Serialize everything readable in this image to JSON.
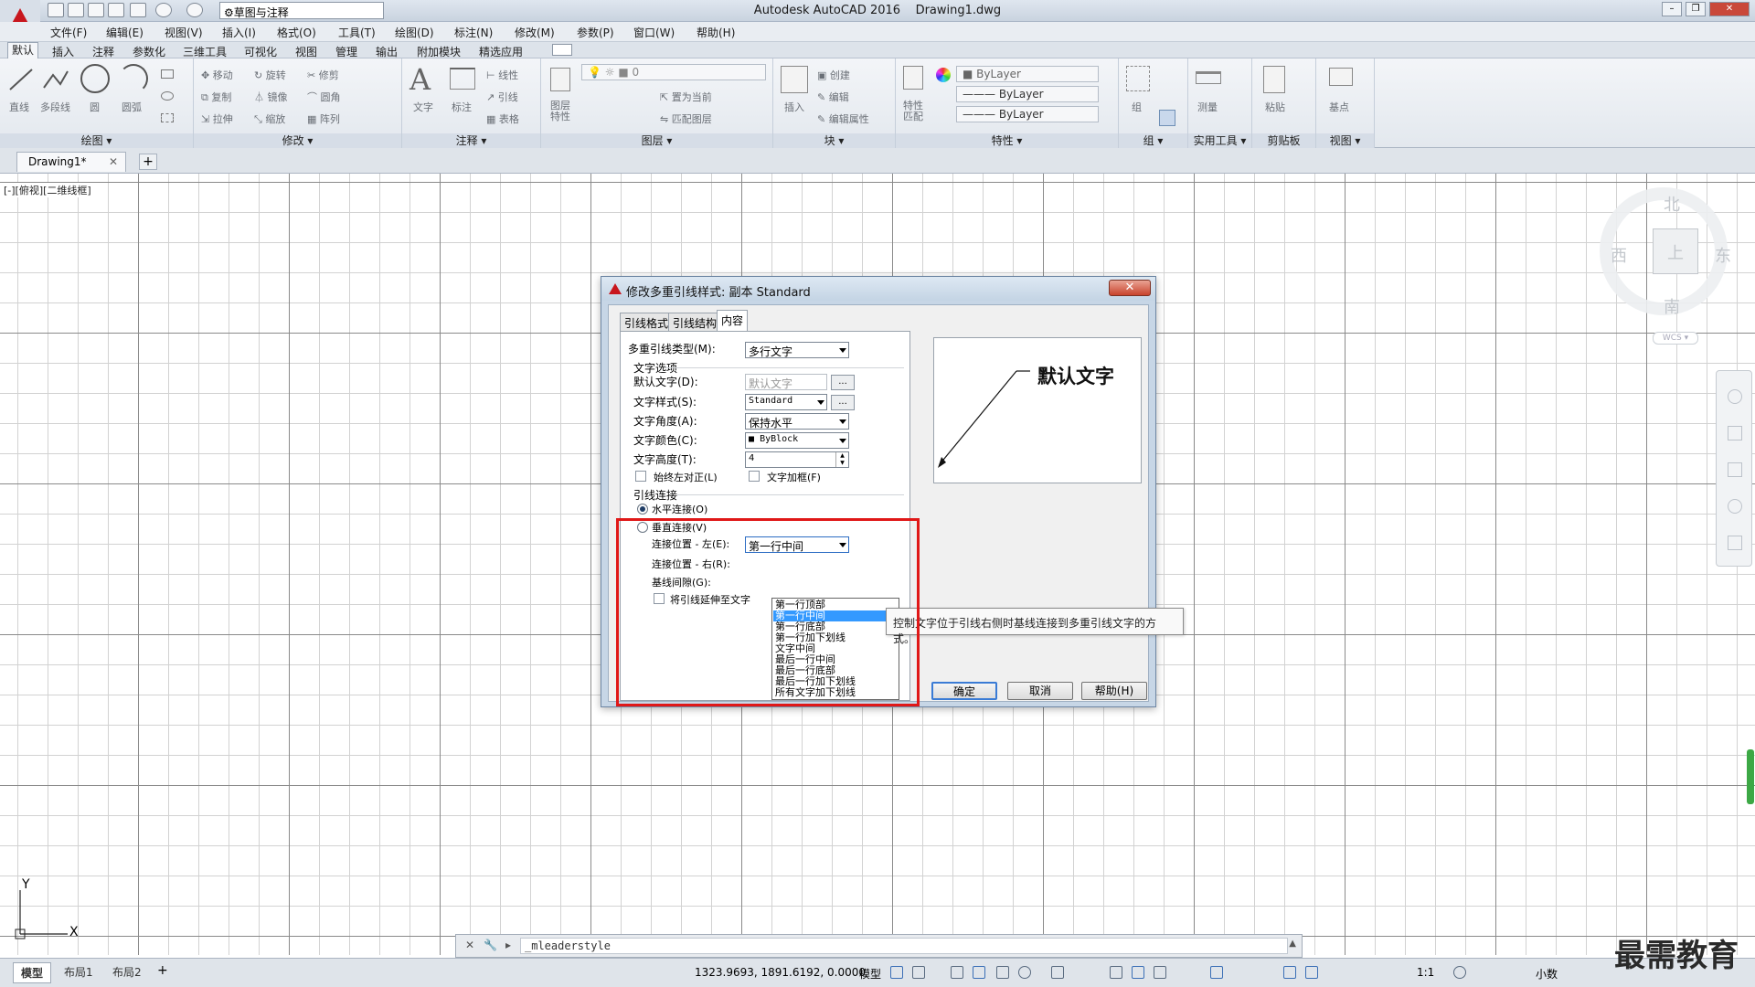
{
  "titlebar": {
    "workspace": "草图与注释",
    "app_title": "Autodesk AutoCAD 2016",
    "drawing_name": "Drawing1.dwg"
  },
  "menubar": [
    "文件(F)",
    "编辑(E)",
    "视图(V)",
    "插入(I)",
    "格式(O)",
    "工具(T)",
    "绘图(D)",
    "标注(N)",
    "修改(M)",
    "参数(P)",
    "窗口(W)",
    "帮助(H)"
  ],
  "ribbon_tabs": [
    "默认",
    "插入",
    "注释",
    "参数化",
    "三维工具",
    "可视化",
    "视图",
    "管理",
    "输出",
    "附加模块",
    "精选应用"
  ],
  "ribbon": {
    "draw": {
      "title": "绘图",
      "tools": [
        "直线",
        "多段线",
        "圆",
        "圆弧"
      ]
    },
    "modify": {
      "title": "修改",
      "tools": [
        "移动",
        "旋转",
        "修剪",
        "复制",
        "镜像",
        "圆角",
        "拉伸",
        "缩放",
        "阵列"
      ]
    },
    "annotation": {
      "title": "注释",
      "tools": [
        "文字",
        "标注",
        "线性",
        "引线",
        "表格"
      ]
    },
    "layers": {
      "title": "图层",
      "tools": [
        "图层特性",
        "置为当前",
        "匹配图层"
      ],
      "current_layer": "0"
    },
    "block": {
      "title": "块",
      "tools": [
        "插入",
        "创建",
        "编辑",
        "编辑属性"
      ]
    },
    "properties": {
      "title": "特性",
      "tools": [
        "特性匹配"
      ],
      "color": "ByLayer",
      "linetype": "ByLayer",
      "lineweight": "ByLayer"
    },
    "groups": {
      "title": "组",
      "tools": [
        "组"
      ]
    },
    "utilities": {
      "title": "实用工具",
      "tools": [
        "测量"
      ]
    },
    "clipboard": {
      "title": "剪贴板",
      "tools": [
        "粘贴"
      ]
    },
    "view": {
      "title": "视图",
      "tools": [
        "基点"
      ]
    }
  },
  "doc_tab": "Drawing1*",
  "viewport_label": "[-][俯视][二维线框]",
  "viewcube": {
    "north": "北",
    "south": "南",
    "east": "东",
    "west": "西",
    "face": "上",
    "wcs": "WCS"
  },
  "ucs": {
    "x": "X",
    "y": "Y"
  },
  "command": {
    "value": "_mleaderstyle"
  },
  "statusbar": {
    "layout_tabs": [
      "模型",
      "布局1",
      "布局2"
    ],
    "coords": "1323.9693, 1891.6192, 0.0000",
    "space": "模型",
    "scale": "1:1",
    "units": "小数"
  },
  "watermark": "最需教育",
  "dialog": {
    "title": "修改多重引线样式: 副本 Standard",
    "tabs": [
      "引线格式",
      "引线结构",
      "内容"
    ],
    "active_tab": "内容",
    "leader_type_label": "多重引线类型(M):",
    "leader_type_value": "多行文字",
    "text_options_group": "文字选项",
    "default_text_label": "默认文字(D):",
    "default_text_value": "默认文字",
    "text_style_label": "文字样式(S):",
    "text_style_value": "Standard",
    "text_angle_label": "文字角度(A):",
    "text_angle_value": "保持水平",
    "text_color_label": "文字颜色(C):",
    "text_color_value": "ByBlock",
    "text_height_label": "文字高度(T):",
    "text_height_value": "4",
    "always_left_label": "始终左对正(L)",
    "frame_text_label": "文字加框(F)",
    "leader_conn_group": "引线连接",
    "horizontal_label": "水平连接(O)",
    "vertical_label": "垂直连接(V)",
    "attach_left_label": "连接位置 - 左(E):",
    "attach_left_value": "第一行中间",
    "attach_right_label": "连接位置 - 右(R):",
    "landing_gap_label": "基线间隙(G):",
    "extend_leader_label": "将引线延伸至文字",
    "ellipsis": "...",
    "preview_text": "默认文字",
    "ok": "确定",
    "cancel": "取消",
    "help": "帮助(H)",
    "close": "✕"
  },
  "dropdown_options": [
    "第一行顶部",
    "第一行中间",
    "第一行底部",
    "第一行加下划线",
    "文字中间",
    "最后一行中间",
    "最后一行底部",
    "最后一行加下划线",
    "所有文字加下划线"
  ],
  "dropdown_selected_index": 1,
  "tooltip": "控制文字位于引线右侧时基线连接到多重引线文字的方式。",
  "colors": {
    "highlight_box": "#e01818",
    "accent": "#3399ff",
    "logo": "#c8161d"
  }
}
